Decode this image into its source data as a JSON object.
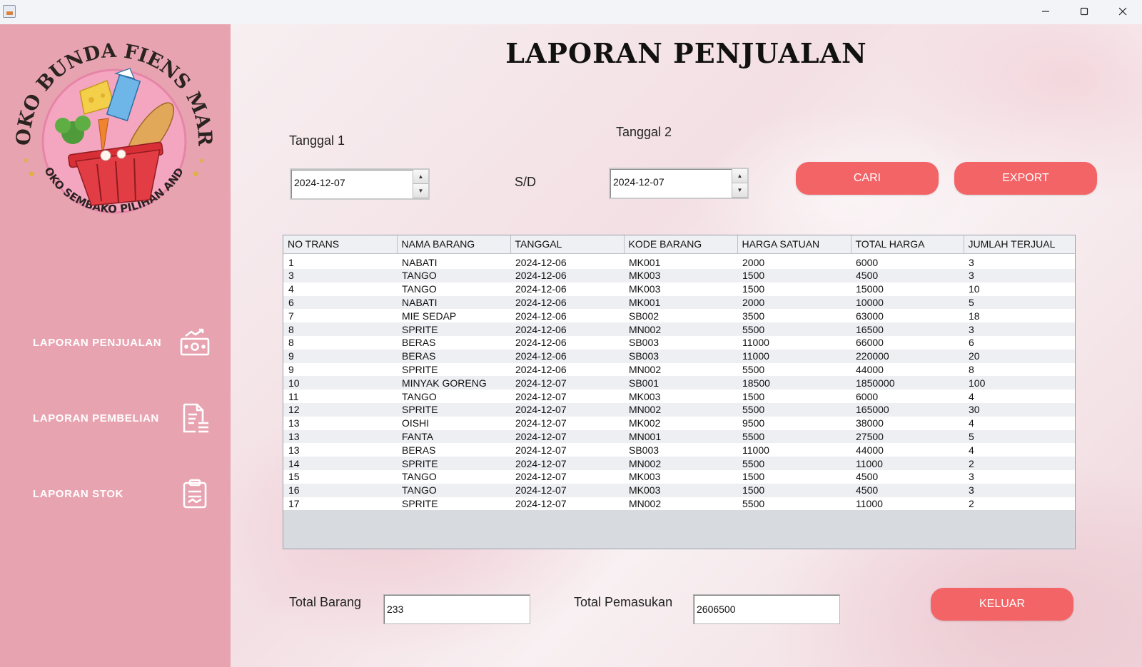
{
  "window": {
    "buttons": {
      "minimize": "minimize-icon",
      "maximize": "maximize-icon",
      "close": "close-icon"
    }
  },
  "sidebar": {
    "logo": {
      "top_text": "TOKO BUNDA FIENS MART",
      "bottom_text": "TOKO SEMBAKO PILIHAN ANDA"
    },
    "items": [
      {
        "label": "LAPORAN PENJUALAN",
        "icon": "money-report-icon"
      },
      {
        "label": "LAPORAN PEMBELIAN",
        "icon": "document-list-icon"
      },
      {
        "label": "LAPORAN STOK",
        "icon": "clipboard-icon"
      }
    ]
  },
  "main": {
    "title": "LAPORAN PENJUALAN",
    "tanggal1_label": "Tanggal 1",
    "tanggal2_label": "Tanggal 2",
    "sd_label": "S/D",
    "tanggal1_value": "2024-12-07",
    "tanggal2_value": "2024-12-07",
    "cari_label": "CARI",
    "export_label": "EXPORT",
    "keluar_label": "KELUAR",
    "total_barang_label": "Total Barang",
    "total_barang_value": "233",
    "total_pemasukan_label": "Total Pemasukan",
    "total_pemasukan_value": "2606500"
  },
  "table": {
    "columns": [
      "NO TRANS",
      "NAMA BARANG",
      "TANGGAL",
      "KODE BARANG",
      "HARGA SATUAN",
      "TOTAL HARGA",
      "JUMLAH TERJUAL"
    ],
    "rows": [
      [
        "1",
        "NABATI",
        "2024-12-06",
        "MK001",
        "2000",
        "6000",
        "3"
      ],
      [
        "3",
        "TANGO",
        "2024-12-06",
        "MK003",
        "1500",
        "4500",
        "3"
      ],
      [
        "4",
        "TANGO",
        "2024-12-06",
        "MK003",
        "1500",
        "15000",
        "10"
      ],
      [
        "6",
        "NABATI",
        "2024-12-06",
        "MK001",
        "2000",
        "10000",
        "5"
      ],
      [
        "7",
        "MIE SEDAP",
        "2024-12-06",
        "SB002",
        "3500",
        "63000",
        "18"
      ],
      [
        "8",
        "SPRITE",
        "2024-12-06",
        "MN002",
        "5500",
        "16500",
        "3"
      ],
      [
        "8",
        "BERAS",
        "2024-12-06",
        "SB003",
        "11000",
        "66000",
        "6"
      ],
      [
        "9",
        "BERAS",
        "2024-12-06",
        "SB003",
        "11000",
        "220000",
        "20"
      ],
      [
        "9",
        "SPRITE",
        "2024-12-06",
        "MN002",
        "5500",
        "44000",
        "8"
      ],
      [
        "10",
        "MINYAK GORENG",
        "2024-12-07",
        "SB001",
        "18500",
        "1850000",
        "100"
      ],
      [
        "11",
        "TANGO",
        "2024-12-07",
        "MK003",
        "1500",
        "6000",
        "4"
      ],
      [
        "12",
        "SPRITE",
        "2024-12-07",
        "MN002",
        "5500",
        "165000",
        "30"
      ],
      [
        "13",
        "OISHI",
        "2024-12-07",
        "MK002",
        "9500",
        "38000",
        "4"
      ],
      [
        "13",
        "FANTA",
        "2024-12-07",
        "MN001",
        "5500",
        "27500",
        "5"
      ],
      [
        "13",
        "BERAS",
        "2024-12-07",
        "SB003",
        "11000",
        "44000",
        "4"
      ],
      [
        "14",
        "SPRITE",
        "2024-12-07",
        "MN002",
        "5500",
        "11000",
        "2"
      ],
      [
        "15",
        "TANGO",
        "2024-12-07",
        "MK003",
        "1500",
        "4500",
        "3"
      ],
      [
        "16",
        "TANGO",
        "2024-12-07",
        "MK003",
        "1500",
        "4500",
        "3"
      ],
      [
        "17",
        "SPRITE",
        "2024-12-07",
        "MN002",
        "5500",
        "11000",
        "2"
      ]
    ]
  },
  "colors": {
    "sidebar": "#e8a3b0",
    "button": "#f36467"
  }
}
